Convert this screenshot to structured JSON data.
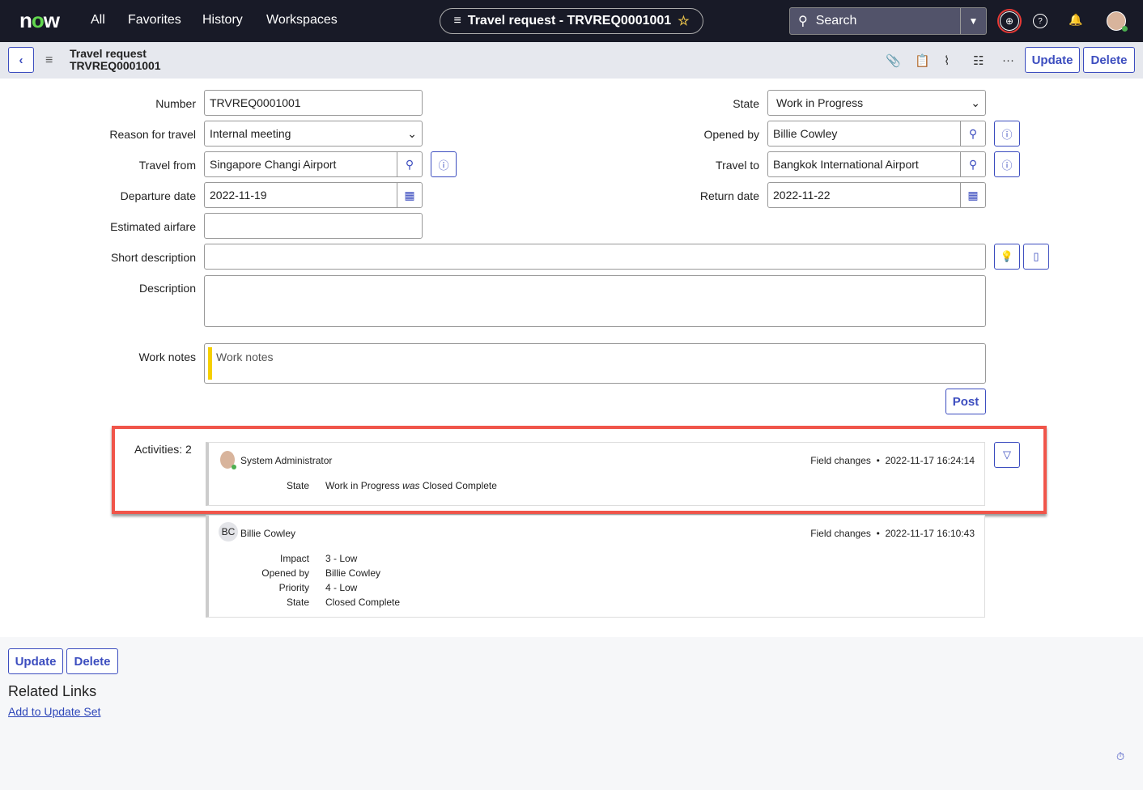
{
  "topbar": {
    "logo": "now",
    "nav": [
      "All",
      "Favorites",
      "History",
      "Workspaces"
    ],
    "record_title": "Travel request - TRVREQ0001001",
    "search_placeholder": "Search",
    "icons": [
      "globe-icon",
      "help-icon",
      "bell-icon",
      "avatar"
    ]
  },
  "subbar": {
    "title": "Travel request",
    "number": "TRVREQ0001001",
    "update": "Update",
    "delete": "Delete"
  },
  "form": {
    "number": {
      "label": "Number",
      "value": "TRVREQ0001001"
    },
    "reason": {
      "label": "Reason for travel",
      "value": "Internal meeting"
    },
    "travel_from": {
      "label": "Travel from",
      "value": "Singapore Changi Airport"
    },
    "departure": {
      "label": "Departure date",
      "value": "2022-11-19"
    },
    "airfare": {
      "label": "Estimated airfare",
      "value": ""
    },
    "state": {
      "label": "State",
      "value": "Work in Progress"
    },
    "opened_by": {
      "label": "Opened by",
      "value": "Billie Cowley"
    },
    "travel_to": {
      "label": "Travel to",
      "value": "Bangkok International Airport"
    },
    "return": {
      "label": "Return date",
      "value": "2022-11-22"
    },
    "short_desc": {
      "label": "Short description",
      "value": ""
    },
    "description": {
      "label": "Description",
      "value": ""
    },
    "work_notes": {
      "label": "Work notes",
      "placeholder": "Work notes"
    },
    "post": "Post"
  },
  "activities": {
    "label": "Activities: 2",
    "entries": [
      {
        "user": "System Administrator",
        "type": "Field changes",
        "time": "2022-11-17 16:24:14",
        "changes": [
          {
            "field": "State",
            "value": "Work in Progress",
            "was_word": "was",
            "old": "Closed Complete"
          }
        ]
      },
      {
        "user": "Billie Cowley",
        "initials": "BC",
        "type": "Field changes",
        "time": "2022-11-17 16:10:43",
        "changes": [
          {
            "field": "Impact",
            "value": "3 - Low"
          },
          {
            "field": "Opened by",
            "value": "Billie Cowley"
          },
          {
            "field": "Priority",
            "value": "4 - Low"
          },
          {
            "field": "State",
            "value": "Closed Complete"
          }
        ]
      }
    ]
  },
  "footer": {
    "update": "Update",
    "delete": "Delete",
    "related_links": "Related Links",
    "add_to_update_set": "Add to Update Set"
  },
  "colors": {
    "accent": "#3c4dbf",
    "header": "#181a27",
    "highlight": "#f0554a"
  }
}
